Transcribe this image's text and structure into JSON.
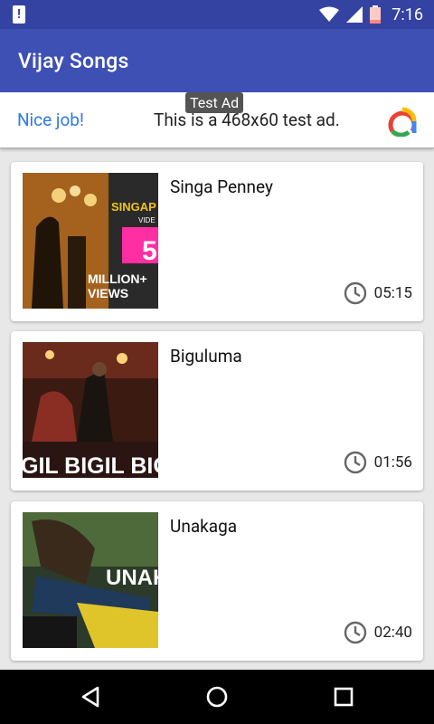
{
  "status": {
    "time": "7:16"
  },
  "app": {
    "title": "Vijay Songs"
  },
  "ad": {
    "nice": "Nice job!",
    "text": "This is a 468x60 test ad.",
    "tag": "Test Ad"
  },
  "songs": [
    {
      "title": "Singa Penney",
      "duration": "05:15",
      "thumb_text": [
        "SINGAP",
        "VIDE",
        "5",
        "MILLION+",
        "VIEWS"
      ]
    },
    {
      "title": "Biguluma",
      "duration": "01:56",
      "thumb_text": "GIL BIGIL BIGIL"
    },
    {
      "title": "Unakaga",
      "duration": "02:40",
      "thumb_text": "UNAK"
    }
  ]
}
